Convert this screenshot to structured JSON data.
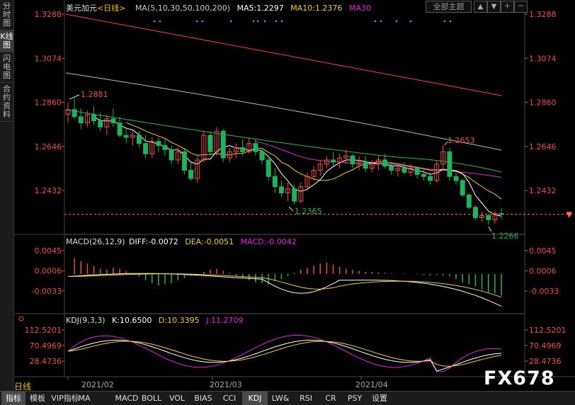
{
  "left_tabs": [
    {
      "label": "分时图",
      "active": false
    },
    {
      "label": "K线图",
      "active": true
    },
    {
      "label": "闪电图",
      "active": false
    },
    {
      "label": "合约资料",
      "active": false
    }
  ],
  "header": {
    "symbol": "美元加元",
    "period_tag": "<日线>",
    "ma_label": "MA(5,10,30,50,100,200)",
    "ma5": "MA5:1.2297",
    "ma10": "MA10:1.2376",
    "ma30": "MA30",
    "theme_button": "全部主题"
  },
  "colors": {
    "up": "#23b15d",
    "down": "#e84d4d",
    "ma5": "#ffffff",
    "ma10": "#f0d020",
    "ma30": "#e020e0",
    "ma50": "#20c040",
    "ma100": "#bbbbbb",
    "ma200": "#ff4040"
  },
  "price_axis": {
    "labels": [
      "1.3288",
      "1.3074",
      "1.2860",
      "1.2646",
      "1.2432"
    ],
    "current": "1.2316"
  },
  "annotations": {
    "high1": "1.2881",
    "high2": "1.2653",
    "low1": "1.2365",
    "low2": "1.2266"
  },
  "macd": {
    "label": "MACD(26,12,9)",
    "diff": "DIFF:-0.0072",
    "dea": "DEA:-0.0051",
    "macd": "MACD:-0.0042",
    "axis": [
      "0.0045",
      "0.0006",
      "-0.0033"
    ]
  },
  "kdj": {
    "label": "KDJ(9,3,3)",
    "k": "K:10.6500",
    "d": "D:10.3395",
    "j": "J:11.2709",
    "axis": [
      "112.5201",
      "70.4969",
      "28.4736"
    ]
  },
  "dates": [
    "2021/02",
    "2021/03",
    "2021/04"
  ],
  "period": "日线",
  "watermark": "FX678",
  "bottom_tabs": [
    "指标",
    "模板",
    "VIP指标",
    "MA",
    "MACD",
    "BOLL",
    "VOL",
    "BIAS",
    "CCI",
    "KDJ",
    "LW&",
    "RSI",
    "CR",
    "PSY",
    "设置"
  ],
  "bottom_active": [
    "指标",
    "KDJ"
  ],
  "chart_data": {
    "type": "candlestick",
    "series": [
      {
        "name": "USDCAD",
        "ohlc": [
          [
            1.2801,
            1.286,
            1.276,
            1.2825
          ],
          [
            1.2825,
            1.2881,
            1.278,
            1.279
          ],
          [
            1.279,
            1.283,
            1.273,
            1.276
          ],
          [
            1.276,
            1.282,
            1.274,
            1.28
          ],
          [
            1.28,
            1.284,
            1.275,
            1.277
          ],
          [
            1.277,
            1.281,
            1.272,
            1.274
          ],
          [
            1.274,
            1.28,
            1.27,
            1.278
          ],
          [
            1.278,
            1.283,
            1.274,
            1.276
          ],
          [
            1.276,
            1.279,
            1.269,
            1.27
          ],
          [
            1.27,
            1.274,
            1.266,
            1.269
          ],
          [
            1.269,
            1.272,
            1.265,
            1.27
          ],
          [
            1.27,
            1.272,
            1.264,
            1.266
          ],
          [
            1.266,
            1.27,
            1.259,
            1.261
          ],
          [
            1.261,
            1.269,
            1.259,
            1.267
          ],
          [
            1.267,
            1.269,
            1.262,
            1.265
          ],
          [
            1.265,
            1.268,
            1.26,
            1.263
          ],
          [
            1.263,
            1.265,
            1.256,
            1.258
          ],
          [
            1.258,
            1.264,
            1.256,
            1.262
          ],
          [
            1.262,
            1.264,
            1.251,
            1.253
          ],
          [
            1.253,
            1.257,
            1.248,
            1.249
          ],
          [
            1.249,
            1.26,
            1.247,
            1.258
          ],
          [
            1.258,
            1.272,
            1.257,
            1.27
          ],
          [
            1.27,
            1.272,
            1.26,
            1.262
          ],
          [
            1.262,
            1.274,
            1.26,
            1.272
          ],
          [
            1.272,
            1.273,
            1.257,
            1.259
          ],
          [
            1.259,
            1.264,
            1.257,
            1.262
          ],
          [
            1.262,
            1.266,
            1.259,
            1.264
          ],
          [
            1.264,
            1.268,
            1.26,
            1.262
          ],
          [
            1.262,
            1.269,
            1.261,
            1.266
          ],
          [
            1.266,
            1.268,
            1.26,
            1.262
          ],
          [
            1.262,
            1.264,
            1.256,
            1.258
          ],
          [
            1.258,
            1.26,
            1.248,
            1.25
          ],
          [
            1.25,
            1.254,
            1.242,
            1.245
          ],
          [
            1.245,
            1.248,
            1.24,
            1.242
          ],
          [
            1.242,
            1.247,
            1.238,
            1.244
          ],
          [
            1.244,
            1.246,
            1.2365,
            1.238
          ],
          [
            1.238,
            1.247,
            1.237,
            1.245
          ],
          [
            1.245,
            1.252,
            1.243,
            1.25
          ],
          [
            1.25,
            1.255,
            1.248,
            1.253
          ],
          [
            1.253,
            1.258,
            1.25,
            1.256
          ],
          [
            1.256,
            1.26,
            1.254,
            1.258
          ],
          [
            1.258,
            1.262,
            1.255,
            1.257
          ],
          [
            1.257,
            1.261,
            1.254,
            1.259
          ],
          [
            1.259,
            1.263,
            1.256,
            1.26
          ],
          [
            1.26,
            1.261,
            1.254,
            1.256
          ],
          [
            1.256,
            1.26,
            1.253,
            1.257
          ],
          [
            1.257,
            1.26,
            1.252,
            1.254
          ],
          [
            1.254,
            1.258,
            1.252,
            1.256
          ],
          [
            1.256,
            1.26,
            1.253,
            1.258
          ],
          [
            1.258,
            1.261,
            1.254,
            1.255
          ],
          [
            1.255,
            1.257,
            1.251,
            1.253
          ],
          [
            1.253,
            1.256,
            1.25,
            1.254
          ],
          [
            1.254,
            1.257,
            1.251,
            1.252
          ],
          [
            1.252,
            1.256,
            1.25,
            1.254
          ],
          [
            1.254,
            1.255,
            1.249,
            1.251
          ],
          [
            1.251,
            1.254,
            1.248,
            1.25
          ],
          [
            1.25,
            1.252,
            1.246,
            1.248
          ],
          [
            1.248,
            1.258,
            1.247,
            1.256
          ],
          [
            1.256,
            1.2653,
            1.253,
            1.262
          ],
          [
            1.262,
            1.264,
            1.248,
            1.25
          ],
          [
            1.25,
            1.252,
            1.246,
            1.248
          ],
          [
            1.248,
            1.249,
            1.24,
            1.241
          ],
          [
            1.241,
            1.242,
            1.234,
            1.235
          ],
          [
            1.235,
            1.236,
            1.229,
            1.23
          ],
          [
            1.23,
            1.233,
            1.228,
            1.231
          ],
          [
            1.231,
            1.232,
            1.2266,
            1.229
          ],
          [
            1.229,
            1.233,
            1.227,
            1.232
          ],
          [
            1.232,
            1.2345,
            1.229,
            1.2316
          ]
        ]
      }
    ]
  }
}
